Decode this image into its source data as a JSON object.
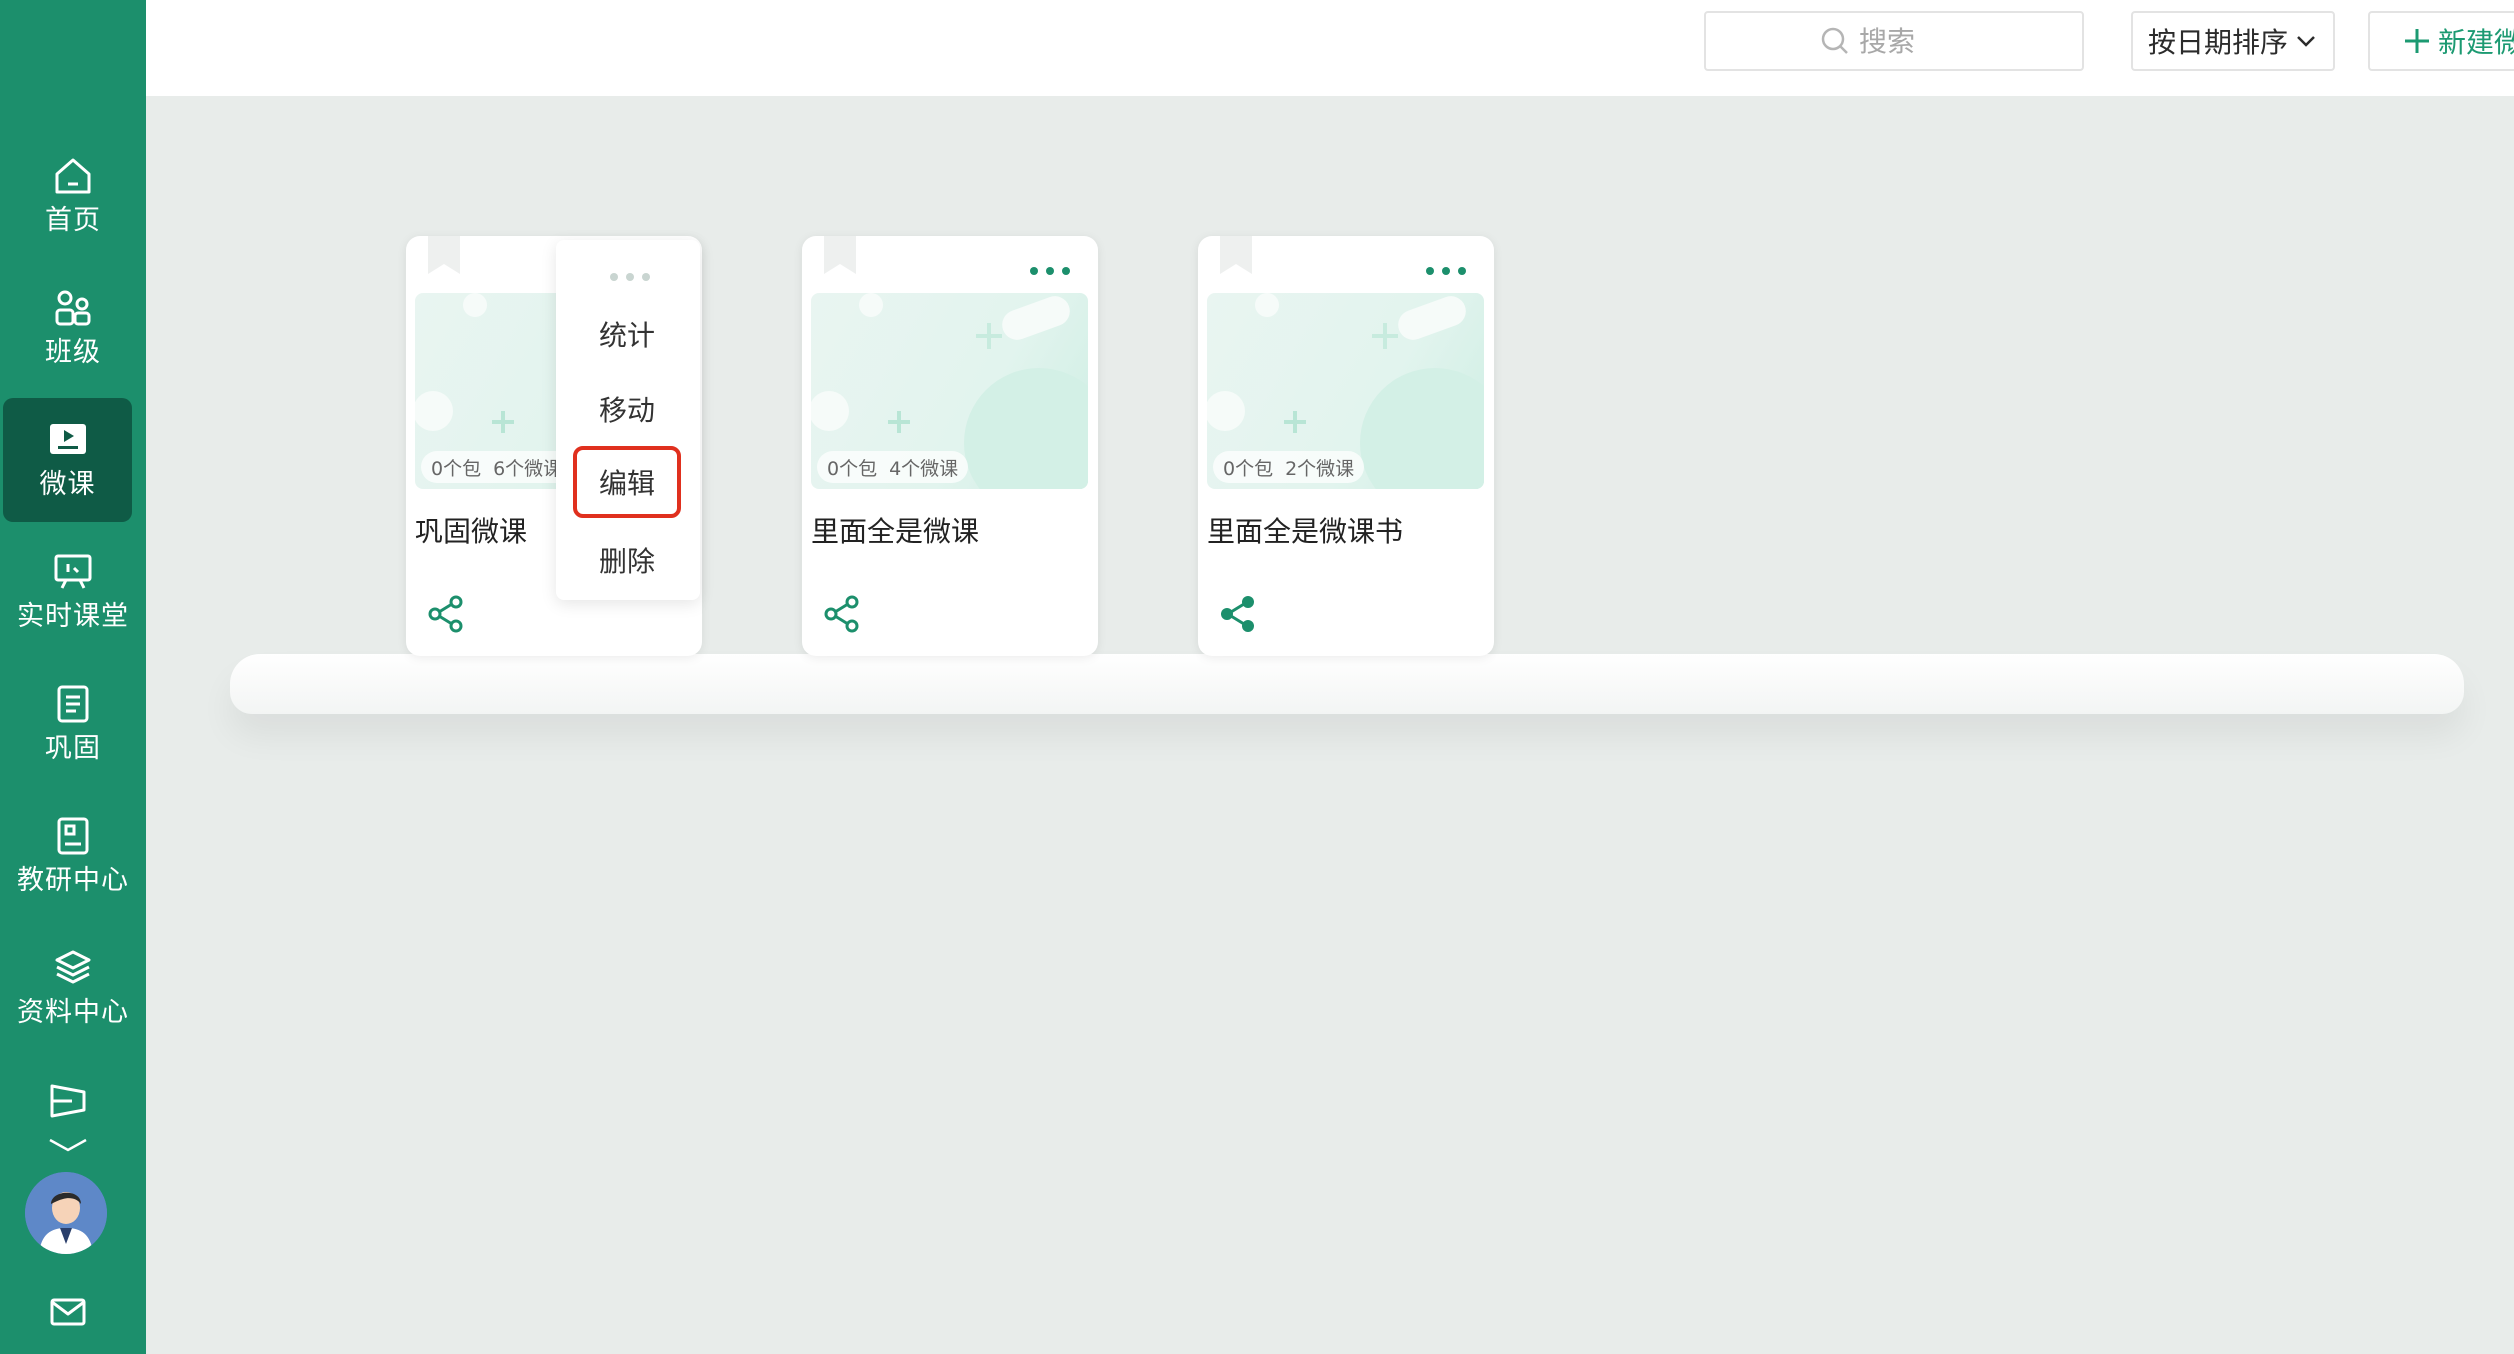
{
  "sidebar": {
    "items": [
      {
        "label": "首页",
        "icon": "home-icon"
      },
      {
        "label": "班级",
        "icon": "users-icon"
      },
      {
        "label": "微课",
        "icon": "video-lesson-icon",
        "active": true
      },
      {
        "label": "实时课堂",
        "icon": "live-class-icon"
      },
      {
        "label": "巩固",
        "icon": "notebook-icon"
      },
      {
        "label": "教研中心",
        "icon": "research-icon"
      },
      {
        "label": "资料中心",
        "icon": "layers-icon"
      }
    ],
    "extra_icon": "send-icon",
    "expand_icon": "chevron-down-icon",
    "avatar_icon": "user-avatar-icon",
    "mail_icon": "mail-icon"
  },
  "header": {
    "search": {
      "placeholder": "搜索",
      "value": ""
    },
    "sort_label": "按日期排序",
    "new_button_label": "新建微课包"
  },
  "cards": [
    {
      "title": "巩固微课",
      "package_count": "0个包",
      "lesson_count": "6个微课"
    },
    {
      "title": "里面全是微课",
      "package_count": "0个包",
      "lesson_count": "4个微课"
    },
    {
      "title": "里面全是微课书",
      "package_count": "0个包",
      "lesson_count": "2个微课"
    }
  ],
  "menu": {
    "items": [
      "统计",
      "移动",
      "编辑",
      "删除"
    ],
    "highlighted": "编辑"
  },
  "colors": {
    "sidebar": "#1c8f6c",
    "sidebar_active": "#0f5b46",
    "accent": "#1c9a72",
    "highlight_border": "#e0301e",
    "background": "#e8ecea"
  }
}
